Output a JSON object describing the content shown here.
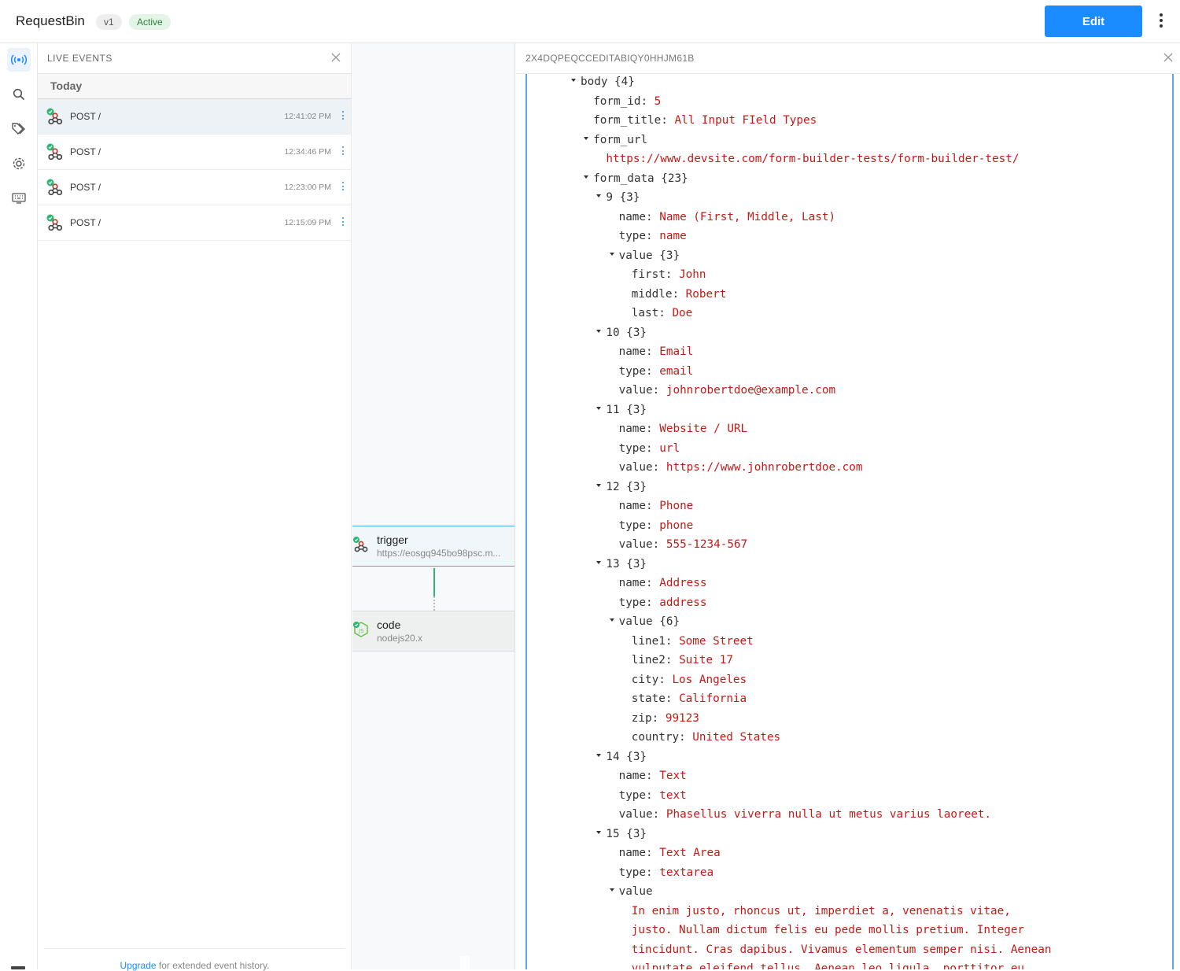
{
  "header": {
    "app_name": "RequestBin",
    "version_badge": "v1",
    "status_badge": "Active",
    "edit_label": "Edit"
  },
  "rail": {
    "icons": [
      "live-events-icon",
      "search-icon",
      "tags-icon",
      "settings-icon",
      "keyboard-icon"
    ]
  },
  "events": {
    "title": "LIVE EVENTS",
    "group_label": "Today",
    "items": [
      {
        "label": "POST /",
        "time": "12:41:02 PM",
        "selected": true
      },
      {
        "label": "POST /",
        "time": "12:34:46 PM",
        "selected": false
      },
      {
        "label": "POST /",
        "time": "12:23:00 PM",
        "selected": false
      },
      {
        "label": "POST /",
        "time": "12:15:09 PM",
        "selected": false
      }
    ],
    "footer_link": "Upgrade",
    "footer_text": " for extended event history."
  },
  "workflow": {
    "trigger": {
      "title": "trigger",
      "subtitle": "https://eosgq945bo98psc.m..."
    },
    "code": {
      "title": "code",
      "subtitle": "nodejs20.x"
    }
  },
  "detail": {
    "event_id": "2X4DQPEQCCEDITABIQY0HHJM61B",
    "lines": [
      {
        "indent": 0,
        "caret": true,
        "key": "body {4}",
        "value": ""
      },
      {
        "indent": 1,
        "caret": false,
        "key": "form_id: ",
        "value": "5"
      },
      {
        "indent": 1,
        "caret": false,
        "key": "form_title: ",
        "value": "All Input FIeld Types"
      },
      {
        "indent": 1,
        "caret": true,
        "key": "form_url",
        "value": ""
      },
      {
        "indent": 2,
        "caret": false,
        "key": "",
        "value": "https://www.devsite.com/form-builder-tests/form-builder-test/"
      },
      {
        "indent": 1,
        "caret": true,
        "key": "form_data {23}",
        "value": ""
      },
      {
        "indent": 2,
        "caret": true,
        "key": "9 {3}",
        "value": ""
      },
      {
        "indent": 3,
        "caret": false,
        "key": "name: ",
        "value": "Name (First, Middle, Last)"
      },
      {
        "indent": 3,
        "caret": false,
        "key": "type: ",
        "value": "name"
      },
      {
        "indent": 3,
        "caret": true,
        "key": "value {3}",
        "value": ""
      },
      {
        "indent": 4,
        "caret": false,
        "key": "first: ",
        "value": "John"
      },
      {
        "indent": 4,
        "caret": false,
        "key": "middle: ",
        "value": "Robert"
      },
      {
        "indent": 4,
        "caret": false,
        "key": "last: ",
        "value": "Doe"
      },
      {
        "indent": 2,
        "caret": true,
        "key": "10 {3}",
        "value": ""
      },
      {
        "indent": 3,
        "caret": false,
        "key": "name: ",
        "value": "Email"
      },
      {
        "indent": 3,
        "caret": false,
        "key": "type: ",
        "value": "email"
      },
      {
        "indent": 3,
        "caret": false,
        "key": "value: ",
        "value": "johnrobertdoe@example.com"
      },
      {
        "indent": 2,
        "caret": true,
        "key": "11 {3}",
        "value": ""
      },
      {
        "indent": 3,
        "caret": false,
        "key": "name: ",
        "value": "Website / URL"
      },
      {
        "indent": 3,
        "caret": false,
        "key": "type: ",
        "value": "url"
      },
      {
        "indent": 3,
        "caret": false,
        "key": "value: ",
        "value": "https://www.johnrobertdoe.com"
      },
      {
        "indent": 2,
        "caret": true,
        "key": "12 {3}",
        "value": ""
      },
      {
        "indent": 3,
        "caret": false,
        "key": "name: ",
        "value": "Phone"
      },
      {
        "indent": 3,
        "caret": false,
        "key": "type: ",
        "value": "phone"
      },
      {
        "indent": 3,
        "caret": false,
        "key": "value: ",
        "value": "555-1234-567"
      },
      {
        "indent": 2,
        "caret": true,
        "key": "13 {3}",
        "value": ""
      },
      {
        "indent": 3,
        "caret": false,
        "key": "name: ",
        "value": "Address"
      },
      {
        "indent": 3,
        "caret": false,
        "key": "type: ",
        "value": "address"
      },
      {
        "indent": 3,
        "caret": true,
        "key": "value {6}",
        "value": ""
      },
      {
        "indent": 4,
        "caret": false,
        "key": "line1: ",
        "value": "Some Street"
      },
      {
        "indent": 4,
        "caret": false,
        "key": "line2: ",
        "value": "Suite 17"
      },
      {
        "indent": 4,
        "caret": false,
        "key": "city: ",
        "value": "Los Angeles"
      },
      {
        "indent": 4,
        "caret": false,
        "key": "state: ",
        "value": "California"
      },
      {
        "indent": 4,
        "caret": false,
        "key": "zip: ",
        "value": "99123"
      },
      {
        "indent": 4,
        "caret": false,
        "key": "country: ",
        "value": "United States"
      },
      {
        "indent": 2,
        "caret": true,
        "key": "14 {3}",
        "value": ""
      },
      {
        "indent": 3,
        "caret": false,
        "key": "name: ",
        "value": "Text"
      },
      {
        "indent": 3,
        "caret": false,
        "key": "type: ",
        "value": "text"
      },
      {
        "indent": 3,
        "caret": false,
        "key": "value: ",
        "value": "Phasellus viverra nulla ut metus varius laoreet."
      },
      {
        "indent": 2,
        "caret": true,
        "key": "15 {3}",
        "value": ""
      },
      {
        "indent": 3,
        "caret": false,
        "key": "name: ",
        "value": "Text Area"
      },
      {
        "indent": 3,
        "caret": false,
        "key": "type: ",
        "value": "textarea"
      },
      {
        "indent": 3,
        "caret": true,
        "key": "value",
        "value": ""
      },
      {
        "indent": 4,
        "caret": false,
        "key": "",
        "value": "In enim justo, rhoncus ut, imperdiet a, venenatis vitae,"
      },
      {
        "indent": 4,
        "caret": false,
        "key": "",
        "value": "justo. Nullam dictum felis eu pede mollis pretium. Integer"
      },
      {
        "indent": 4,
        "caret": false,
        "key": "",
        "value": "tincidunt. Cras dapibus. Vivamus elementum semper nisi. Aenean"
      },
      {
        "indent": 4,
        "caret": false,
        "key": "",
        "value": "vulputate eleifend tellus. Aenean leo ligula, porttitor eu,"
      }
    ]
  },
  "colors": {
    "accent": "#1a8cff",
    "status_green": "#2bb673",
    "json_value": "#c41a16",
    "json_border": "#5aa9e0"
  }
}
